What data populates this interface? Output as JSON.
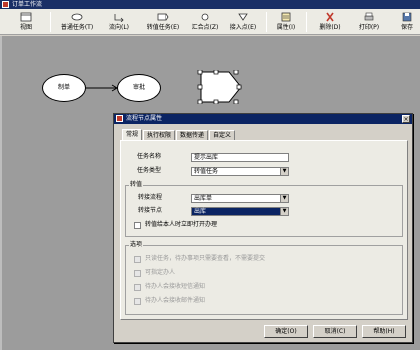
{
  "app": {
    "title": "订单工作流"
  },
  "toolbar": {
    "view": "视图",
    "normal_task": "普通任务(T)",
    "flow": "流向(L)",
    "transfer_task": "转值任务(E)",
    "merge_point": "汇合点(Z)",
    "entry_point": "接入点(E)",
    "properties": "属性(I)",
    "delete": "删除(D)",
    "print": "打印(P)",
    "save": "保存"
  },
  "canvas": {
    "node_draft": "制单",
    "node_review": "审批"
  },
  "dialog": {
    "title": "流程节点属性",
    "close": "×",
    "tabs": [
      "常规",
      "执行权限",
      "数据传递",
      "自定义"
    ],
    "task_name_label": "任务名称",
    "task_name_value": "提示出库",
    "task_type_label": "任务类型",
    "task_type_value": "转值任务",
    "transfer_group": "转值",
    "transfer_flow_label": "转接流程",
    "transfer_flow_value": "出库单",
    "transfer_node_label": "转接节点",
    "transfer_node_value": "出库",
    "open_immediately_label": "转值给本人时立即打开办理",
    "options_group": "选项",
    "options": [
      "只读任务，待办事项只需要查看，不需要提交",
      "可指定办人",
      "待办人会接收短信通知",
      "待办人会接收邮件通知"
    ],
    "ok": "确定(O)",
    "cancel": "取消(C)",
    "help": "帮助(H)"
  }
}
